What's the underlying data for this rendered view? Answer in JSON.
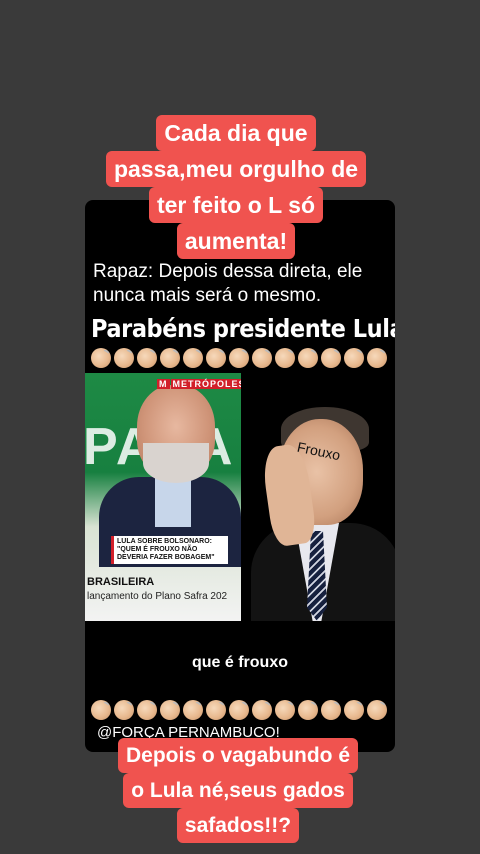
{
  "top_caption": {
    "lines": [
      "Cada dia que",
      "passa,meu orgulho de",
      "ter feito o L só",
      "aumenta!"
    ]
  },
  "post": {
    "subtitle_line1": "Rapaz: Depois dessa direta, ele",
    "subtitle_line2": "nunca mais será o mesmo.",
    "headline": "Parabéns presidente Lula!",
    "clap_emoji_count": 13,
    "left_photo": {
      "logo": "METRÓPOLES",
      "caption_line1": "LULA SOBRE BOLSONARO:",
      "caption_line2": "\"QUEM É FROUXO NÃO",
      "caption_line3": "DEVERIA FAZER BOBAGEM\"",
      "bg_word": "PARA",
      "lower_bold": "BRASILEIRA",
      "lower_text": "lançamento do Plano Safra 202"
    },
    "right_photo": {
      "overlay_label": "Frouxo"
    },
    "spoken_text": "que é frouxo",
    "handle": "@FORÇA PERNAMBUCO!"
  },
  "bottom_caption": {
    "lines": [
      "Depois o vagabundo é",
      "o Lula né,seus gados",
      "safados!!?"
    ]
  },
  "colors": {
    "background": "#3a3a3a",
    "caption_bg": "#f0534f",
    "card_bg": "#000000"
  },
  "icons": {
    "clap": "clapping-hands-icon"
  }
}
